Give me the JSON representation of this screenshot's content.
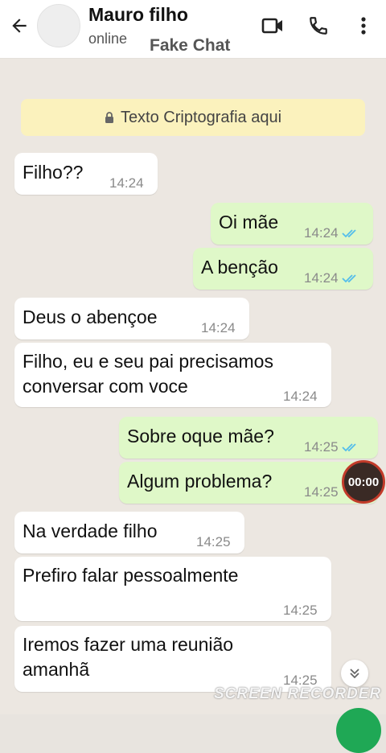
{
  "header": {
    "contact_name": "Mauro filho",
    "status": "online",
    "watermark": "Fake Chat"
  },
  "notice": {
    "text": "Texto Criptografia aqui"
  },
  "messages": [
    {
      "dir": "in",
      "text": "Filho??",
      "time": "14:24"
    },
    {
      "dir": "out",
      "text": "Oi mãe",
      "time": "14:24",
      "ticks": "read"
    },
    {
      "dir": "out",
      "text": "A benção",
      "time": "14:24",
      "ticks": "read"
    },
    {
      "dir": "in",
      "text": "Deus o abençoe",
      "time": "14:24"
    },
    {
      "dir": "in",
      "lines": [
        "Filho, eu e seu pai precisamos",
        "conversar com voce"
      ],
      "time": "14:24"
    },
    {
      "dir": "out",
      "text": "Sobre oque mãe?",
      "time": "14:25",
      "ticks": "read"
    },
    {
      "dir": "out",
      "text": "Algum problema?",
      "time": "14:25"
    },
    {
      "dir": "in",
      "text": "Na verdade filho",
      "time": "14:25"
    },
    {
      "dir": "in",
      "text": "Prefiro falar pessoalmente",
      "time": "14:25"
    },
    {
      "dir": "in",
      "lines": [
        "Iremos fazer uma reunião",
        "amanhã"
      ],
      "time": "14:25"
    }
  ],
  "recorder": {
    "timer": "00:00",
    "watermark": "SCREEN RECORDER"
  },
  "colors": {
    "incoming_bubble": "#ffffff",
    "outgoing_bubble": "#dff8c8",
    "notice_bg": "#fbf2bd",
    "read_ticks": "#53bdeb",
    "chat_bg": "#ece7e1"
  },
  "icons": {
    "back": "arrow-left-icon",
    "video": "video-camera-icon",
    "call": "phone-icon",
    "menu": "more-vertical-icon",
    "lock": "lock-icon",
    "scroll": "double-chevron-down-icon"
  }
}
